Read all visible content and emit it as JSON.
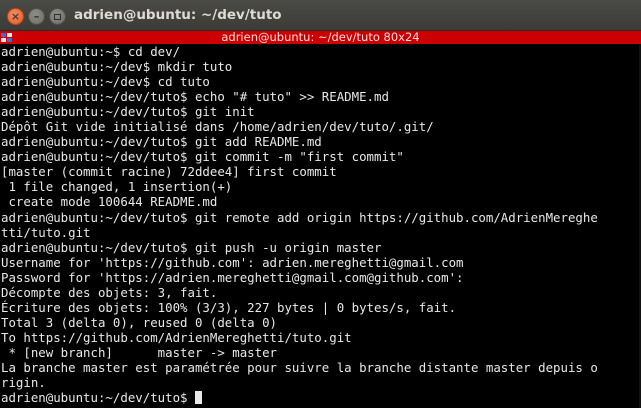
{
  "window": {
    "title": "adrien@ubuntu: ~/dev/tuto",
    "close_glyph": "×",
    "minimize_glyph": "–"
  },
  "status_bar": {
    "text": "adrien@ubuntu: ~/dev/tuto 80x24",
    "color": "#cc0000"
  },
  "terminal": {
    "background": "#000000",
    "foreground": "#e8e8e8",
    "lines": [
      "adrien@ubuntu:~$ cd dev/",
      "adrien@ubuntu:~/dev$ mkdir tuto",
      "adrien@ubuntu:~/dev$ cd tuto",
      "adrien@ubuntu:~/dev/tuto$ echo \"# tuto\" >> README.md",
      "adrien@ubuntu:~/dev/tuto$ git init",
      "Dépôt Git vide initialisé dans /home/adrien/dev/tuto/.git/",
      "adrien@ubuntu:~/dev/tuto$ git add README.md",
      "adrien@ubuntu:~/dev/tuto$ git commit -m \"first commit\"",
      "[master (commit racine) 72ddee4] first commit",
      " 1 file changed, 1 insertion(+)",
      " create mode 100644 README.md",
      "adrien@ubuntu:~/dev/tuto$ git remote add origin https://github.com/AdrienMereghe",
      "tti/tuto.git",
      "adrien@ubuntu:~/dev/tuto$ git push -u origin master",
      "Username for 'https://github.com': adrien.mereghetti@gmail.com",
      "Password for 'https://adrien.mereghetti@gmail.com@github.com':",
      "Décompte des objets: 3, fait.",
      "Écriture des objets: 100% (3/3), 227 bytes | 0 bytes/s, fait.",
      "Total 3 (delta 0), reused 0 (delta 0)",
      "To https://github.com/AdrienMereghetti/tuto.git",
      " * [new branch]      master -> master",
      "La branche master est paramétrée pour suivre la branche distante master depuis o",
      "rigin."
    ],
    "prompt": "adrien@ubuntu:~/dev/tuto$ "
  }
}
